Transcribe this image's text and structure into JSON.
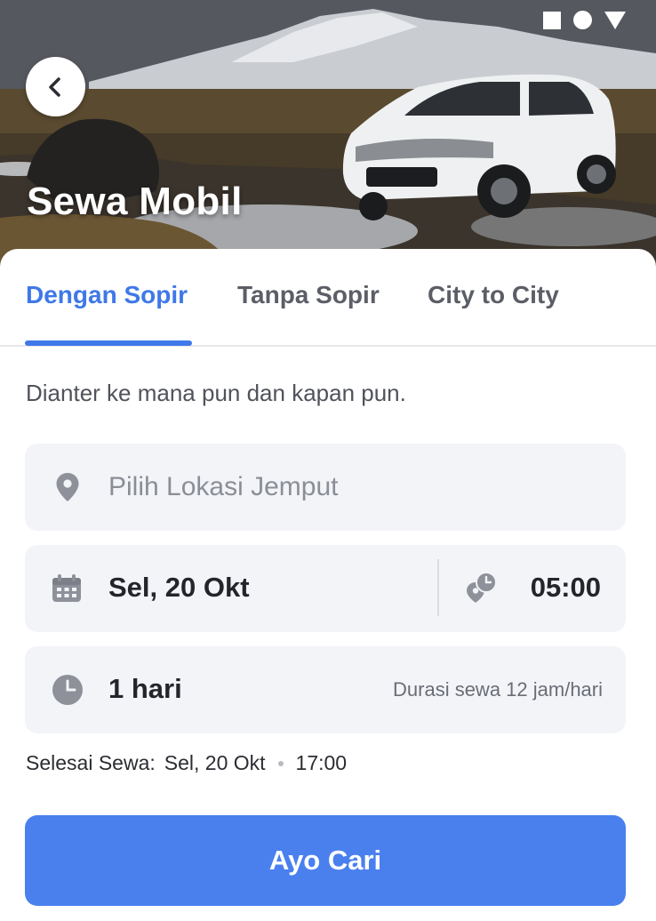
{
  "header": {
    "title": "Sewa Mobil",
    "back_icon": "chevron-left-icon"
  },
  "status_bar": {
    "icons": [
      "square-icon",
      "circle-icon",
      "triangle-icon"
    ]
  },
  "tabs": [
    {
      "label": "Dengan Sopir",
      "active": true
    },
    {
      "label": "Tanpa Sopir",
      "active": false
    },
    {
      "label": "City to City",
      "active": false
    }
  ],
  "subtitle": "Dianter ke mana pun dan kapan pun.",
  "pickup": {
    "placeholder": "Pilih Lokasi Jemput",
    "icon": "location-pin-icon"
  },
  "schedule": {
    "date": "Sel, 20 Okt",
    "date_icon": "calendar-icon",
    "time": "05:00",
    "time_icon": "pickup-time-icon"
  },
  "duration": {
    "value": "1 hari",
    "icon": "clock-icon",
    "note": "Durasi sewa 12 jam/hari"
  },
  "end": {
    "label": "Selesai Sewa:",
    "date": "Sel, 20 Okt",
    "time": "17:00"
  },
  "cta": {
    "label": "Ayo Cari"
  },
  "colors": {
    "accent": "#3f78e8",
    "button": "#4a80ee",
    "card_bg": "#f3f4f8"
  }
}
